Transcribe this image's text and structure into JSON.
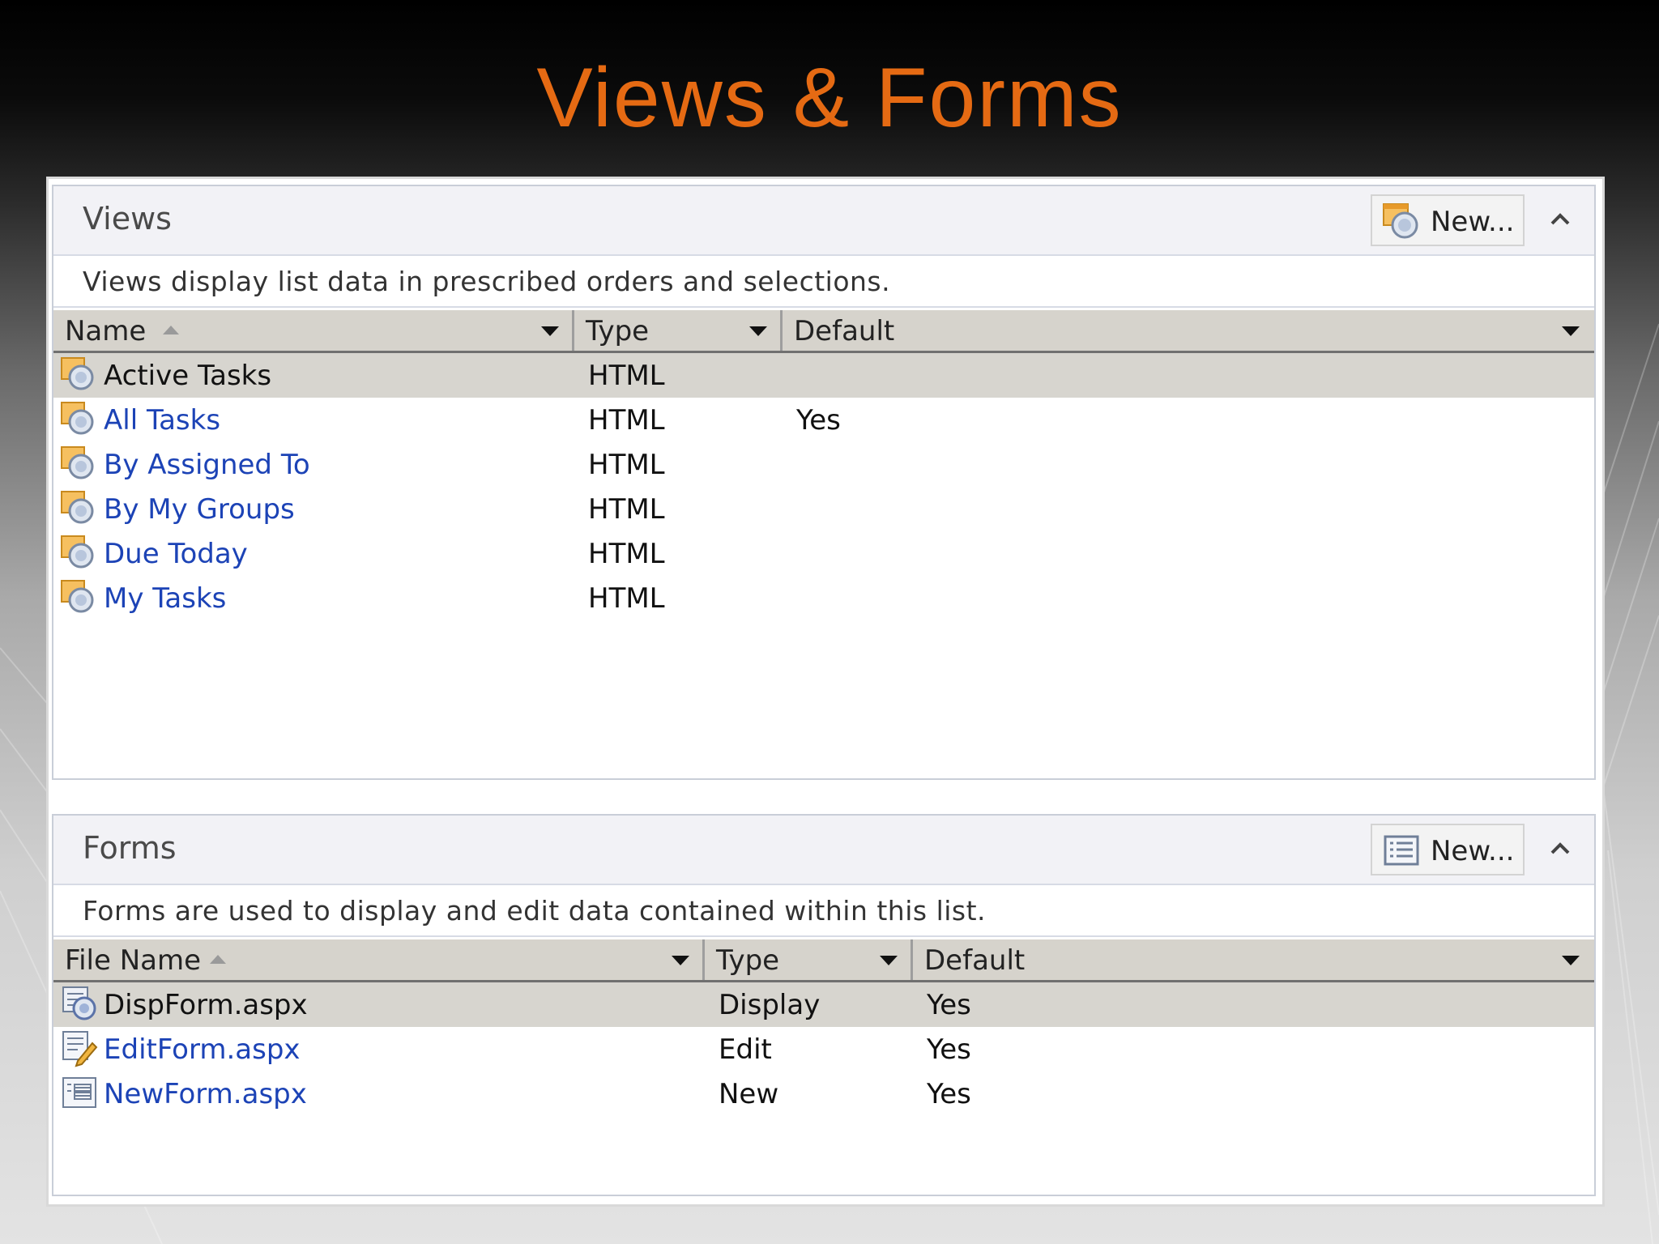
{
  "slide": {
    "title": "Views & Forms"
  },
  "colors": {
    "title": "#e56a13",
    "link": "#1c43b6",
    "selected_row": "#d7d5cf"
  },
  "views": {
    "title": "Views",
    "new_label": "New...",
    "new_icon": "view-icon",
    "collapse_icon": "chevron-up-icon",
    "description": "Views display list data in prescribed orders and selections.",
    "columns": [
      "Name",
      "Type",
      "Default"
    ],
    "sort_column": "Name",
    "rows": [
      {
        "name": "Active Tasks",
        "type": "HTML",
        "default": "",
        "selected": true,
        "icon": "view-icon"
      },
      {
        "name": "All Tasks",
        "type": "HTML",
        "default": "Yes",
        "icon": "view-icon"
      },
      {
        "name": "By Assigned To",
        "type": "HTML",
        "default": "",
        "icon": "view-icon"
      },
      {
        "name": "By My Groups",
        "type": "HTML",
        "default": "",
        "icon": "view-icon"
      },
      {
        "name": "Due Today",
        "type": "HTML",
        "default": "",
        "icon": "view-icon"
      },
      {
        "name": "My Tasks",
        "type": "HTML",
        "default": "",
        "icon": "view-icon"
      }
    ]
  },
  "forms": {
    "title": "Forms",
    "new_label": "New...",
    "new_icon": "form-icon",
    "collapse_icon": "chevron-up-icon",
    "description": "Forms are used to display and edit data contained within this list.",
    "columns": [
      "File Name",
      "Type",
      "Default"
    ],
    "sort_column": "File Name",
    "rows": [
      {
        "name": "DispForm.aspx",
        "type": "Display",
        "default": "Yes",
        "selected": true,
        "icon": "display-form-icon"
      },
      {
        "name": "EditForm.aspx",
        "type": "Edit",
        "default": "Yes",
        "icon": "edit-form-icon"
      },
      {
        "name": "NewForm.aspx",
        "type": "New",
        "default": "Yes",
        "icon": "new-form-icon"
      }
    ]
  }
}
